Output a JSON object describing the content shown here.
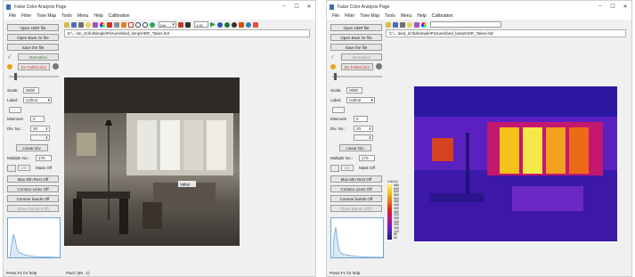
{
  "left": {
    "title": "False Color Analysis Page",
    "window_controls": [
      "–",
      "☐",
      "✕"
    ],
    "menu": [
      "File",
      "Filter",
      "Tone Map",
      "Tools",
      "Menu",
      "Help",
      "Calibration"
    ],
    "toolbar_field": "1:00",
    "toolbar_combo": "Def",
    "path": "E:\\...\\Im_2c\\fullsimple\\Pictures\\bed_lamp\\HDR_Takes.hdr",
    "buttons": {
      "open_hdr": "Open HDR file",
      "open_back": "Open Back Gr file",
      "save": "Save the file",
      "normalize": "Normalize",
      "falsecolor": "Do FalseColor",
      "linear": "Linear Div.",
      "max_min": "Max Min Rect Off",
      "contour_lines": "Contour Lines Off",
      "contour_bands": "Contour bands Off",
      "show_bands": "Show Bands (Off)"
    },
    "labels": {
      "scale": "Scale:",
      "label": "Label:",
      "minimum": "Minimum",
      "div": "Div. No.:",
      "multiple": "Multiple No.:",
      "mask": "Mask Off"
    },
    "values": {
      "scale": "0000",
      "label": "Cd/m2",
      "minimum": "0",
      "div": "20",
      "multiple": "170",
      "mask": "100"
    },
    "status": "Press F1 for help",
    "pixel": "Pixel:   (59 , 1)",
    "image_overlay": "Value"
  },
  "right": {
    "title": "False Color Analysis Page",
    "window_controls": [
      "–",
      "☐",
      "✕"
    ],
    "menu": [
      "File",
      "Filter",
      "Tone Map",
      "Tools",
      "Menu",
      "Help",
      "Calibration"
    ],
    "path": "C:\\...\\bed_2c\\fullsimple\\Pictures\\bed_lamp\\HDR_Takes.hdr",
    "buttons": {
      "open_hdr": "Open HDR file",
      "open_back": "Open Back Gr file",
      "save": "Save the file",
      "normalize": "Normalize",
      "falsecolor": "Do FalseColor",
      "linear": "Linear Div.",
      "max_min": "Max Min Rect Off",
      "contour_lines": "Contour Lines Off",
      "contour_bands": "Contour bands Off",
      "show_bands": "Show Bands (Off)"
    },
    "labels": {
      "scale": "Scale:",
      "label": "Label:",
      "minimum": "Minimum",
      "div": "Div. No.:",
      "multiple": "Multiple No.:",
      "mask": "Mask Off"
    },
    "values": {
      "scale": "0000",
      "label": "Cd/m2",
      "minimum": "0",
      "div": "20",
      "multiple": "170",
      "mask": "100"
    },
    "status": "Press F1 for help",
    "legend": {
      "title": "Cd/m2",
      "ticks": [
        "680",
        "640",
        "600",
        "560",
        "520",
        "480",
        "440",
        "400",
        "360",
        "320",
        "280",
        "240",
        "200",
        "160",
        "120",
        "80",
        "40"
      ]
    }
  },
  "colors": {
    "accent": "#6fa3d6",
    "histogram_fill": "#d9e8f7"
  },
  "icons": [
    "folder-icon",
    "save-icon",
    "zoom-icon",
    "brush-icon",
    "color-wheel-icon",
    "play-icon",
    "record-icon"
  ]
}
